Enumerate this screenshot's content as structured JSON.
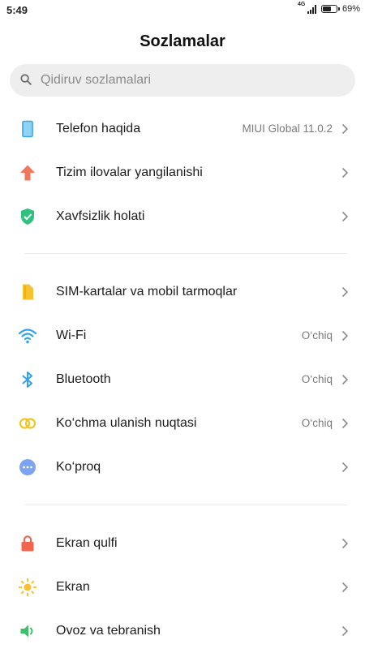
{
  "status_bar": {
    "time": "5:49",
    "network": "4G",
    "battery_percent": "69%",
    "battery_level": 0.69
  },
  "header": {
    "title": "Sozlamalar"
  },
  "search": {
    "placeholder": "Qidiruv sozlamalari",
    "icon": "search-icon"
  },
  "sections": [
    [
      {
        "label": "Telefon haqida",
        "value": "MIUI Global 11.0.2",
        "icon": "phone-icon",
        "color": "#4fb4ea"
      },
      {
        "label": "Tizim ilovalar yangilanishi",
        "value": "",
        "icon": "arrow-up-icon",
        "color": "#f2765a"
      },
      {
        "label": "Xavfsizlik holati",
        "value": "",
        "icon": "shield-icon",
        "color": "#2ec27e"
      }
    ],
    [
      {
        "label": "SIM-kartalar va mobil tarmoqlar",
        "value": "",
        "icon": "sim-card-icon",
        "color": "#f7c22e"
      },
      {
        "label": "Wi-Fi",
        "value": "O‘chiq",
        "icon": "wifi-icon",
        "color": "#2ea2ea"
      },
      {
        "label": "Bluetooth",
        "value": "O‘chiq",
        "icon": "bluetooth-icon",
        "color": "#2ea2ea"
      },
      {
        "label": "Ko‘chma ulanish nuqtasi",
        "value": "O‘chiq",
        "icon": "hotspot-icon",
        "color": "#f5c320"
      },
      {
        "label": "Ko‘proq",
        "value": "",
        "icon": "more-icon",
        "color": "#7da4f0"
      }
    ],
    [
      {
        "label": "Ekran qulfi",
        "value": "",
        "icon": "lock-icon",
        "color": "#f0664f"
      },
      {
        "label": "Ekran",
        "value": "",
        "icon": "brightness-icon",
        "color": "#f7c22e"
      },
      {
        "label": "Ovoz va tebranish",
        "value": "",
        "icon": "speaker-icon",
        "color": "#3dbf6e"
      }
    ]
  ]
}
